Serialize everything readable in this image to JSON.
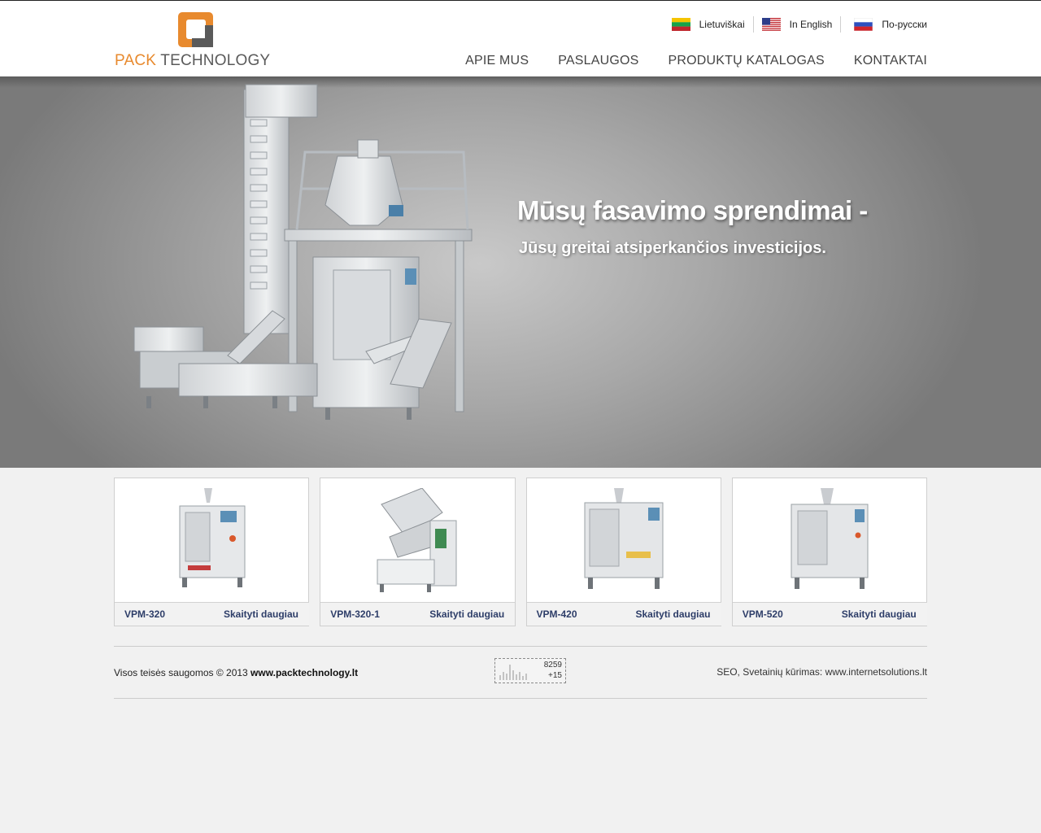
{
  "brand": {
    "word1": "PACK",
    "word2": "TECHNOLOGY",
    "orange": "#e88a2e",
    "gray": "#5a5a5a"
  },
  "languages": [
    {
      "label": "Lietuviškai",
      "flag": "lt-flag-icon"
    },
    {
      "label": "In English",
      "flag": "us-flag-icon"
    },
    {
      "label": "По-русски",
      "flag": "ru-flag-icon"
    }
  ],
  "nav": [
    {
      "label": "APIE MUS"
    },
    {
      "label": "PASLAUGOS"
    },
    {
      "label": "PRODUKTŲ KATALOGAS"
    },
    {
      "label": "KONTAKTAI"
    }
  ],
  "hero": {
    "title": "Mūsų fasavimo sprendimai -",
    "subtitle": "Jūsų greitai atsiperkančios investicijos."
  },
  "products": [
    {
      "name": "VPM-320",
      "more": "Skaityti daugiau"
    },
    {
      "name": "VPM-320-1",
      "more": "Skaityti daugiau"
    },
    {
      "name": "VPM-420",
      "more": "Skaityti daugiau"
    },
    {
      "name": "VPM-520",
      "more": "Skaityti daugiau"
    }
  ],
  "footer": {
    "copyright": "Visos teisės saugomos © 2013 ",
    "site": "www.packtechnology.lt",
    "counter_total": "8259",
    "counter_today": "+15",
    "seo": "SEO, Svetainių kūrimas: www.internetsolutions.lt"
  }
}
